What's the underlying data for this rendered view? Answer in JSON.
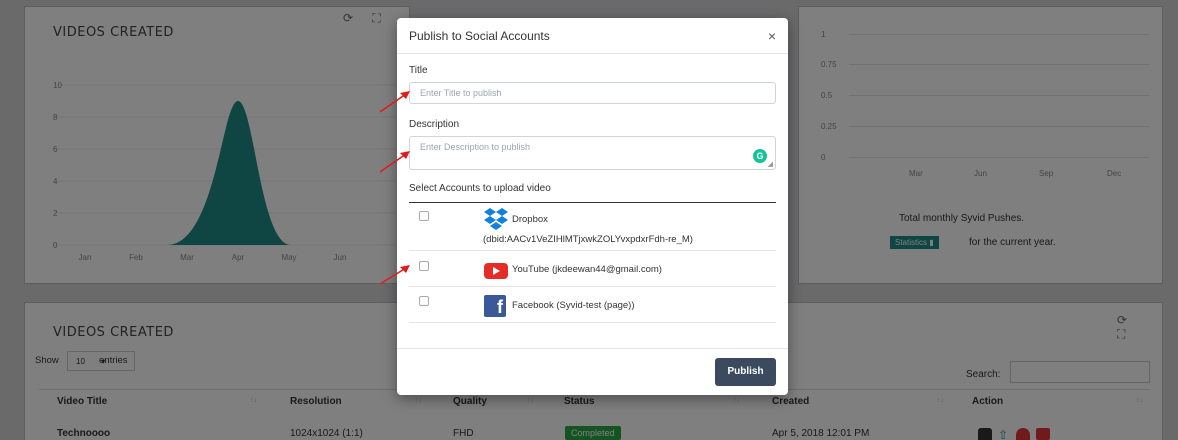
{
  "chart_left": {
    "title": "VIDEOS CREATED",
    "chart_data": {
      "type": "area",
      "categories": [
        "Jan",
        "Feb",
        "Mar",
        "Apr",
        "May",
        "Jun"
      ],
      "values": [
        0,
        0,
        0,
        9,
        0,
        0
      ],
      "y_ticks": [
        "10",
        "8",
        "6",
        "4",
        "2",
        "0"
      ],
      "ylim": [
        0,
        10
      ],
      "color": "#1e8b85"
    }
  },
  "chart_right": {
    "y_ticks": [
      "1",
      "0.75",
      "0.5",
      "0.25",
      "0"
    ],
    "x_ticks": [
      "Mar",
      "Jun",
      "Sep",
      "Dec"
    ],
    "caption": "Total monthly Syvid Pushes.",
    "statistics_label": "Statistics",
    "caption_suffix": "for the current year.",
    "accent_color": "#1e8b85"
  },
  "table_panel": {
    "title": "VIDEOS CREATED",
    "show_label": "Show",
    "entries_value": "10",
    "entries_label": "entries",
    "search_label": "Search:",
    "columns": [
      "Video Title",
      "Resolution",
      "Quality",
      "Status",
      "Created",
      "Action"
    ],
    "rows": [
      {
        "title": "Technoooo",
        "resolution": "1024x1024 (1:1)",
        "quality": "FHD",
        "status": "Completed",
        "created": "Apr 5, 2018 12:01 PM"
      }
    ]
  },
  "modal": {
    "title": "Publish to Social Accounts",
    "close": "×",
    "title_label": "Title",
    "title_placeholder": "Enter Title to publish",
    "description_label": "Description",
    "description_placeholder": "Enter Description to publish",
    "accounts_label": "Select Accounts to upload video",
    "accounts": [
      {
        "name": "Dropbox",
        "detail": "(dbid:AACv1VeZIHlMTjxwkZOLYvxpdxrFdh-re_M)",
        "icon": "dropbox-icon"
      },
      {
        "name": "YouTube (jkdeewan44@gmail.com)",
        "icon": "youtube-icon"
      },
      {
        "name": "Facebook (Syvid-test (page))",
        "icon": "facebook-icon"
      }
    ],
    "publish_label": "Publish"
  }
}
